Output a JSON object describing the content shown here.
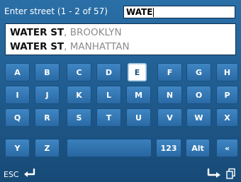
{
  "header": {
    "prompt": "Enter street (1 - 2 of 57)",
    "input_value": "WATE"
  },
  "results": [
    {
      "street": "WATER ST",
      "separator": ", ",
      "city": "BROOKLYN"
    },
    {
      "street": "WATER ST",
      "separator": ", ",
      "city": "MANHATTAN"
    }
  ],
  "keyboard": {
    "row1": [
      "A",
      "B",
      "C",
      "D",
      "E",
      "F",
      "G",
      "H"
    ],
    "row2": [
      "I",
      "J",
      "K",
      "L",
      "M",
      "N",
      "O",
      "P"
    ],
    "row3": [
      "Q",
      "R",
      "S",
      "T",
      "U",
      "V",
      "W",
      "X"
    ],
    "row4": {
      "y": "Y",
      "z": "Z",
      "space": "",
      "num": "123",
      "alt": "Alt",
      "back": "«"
    },
    "selected": "E"
  },
  "bottom": {
    "esc_label": "ESC",
    "icons": [
      "enter-arrow-icon",
      "next-arrow-icon",
      "copy-pages-icon"
    ]
  },
  "colors": {
    "background": "#1f5a8c",
    "key": "#3578b4",
    "selected_key": "#ffffff",
    "city_text": "#8c8c8c"
  }
}
